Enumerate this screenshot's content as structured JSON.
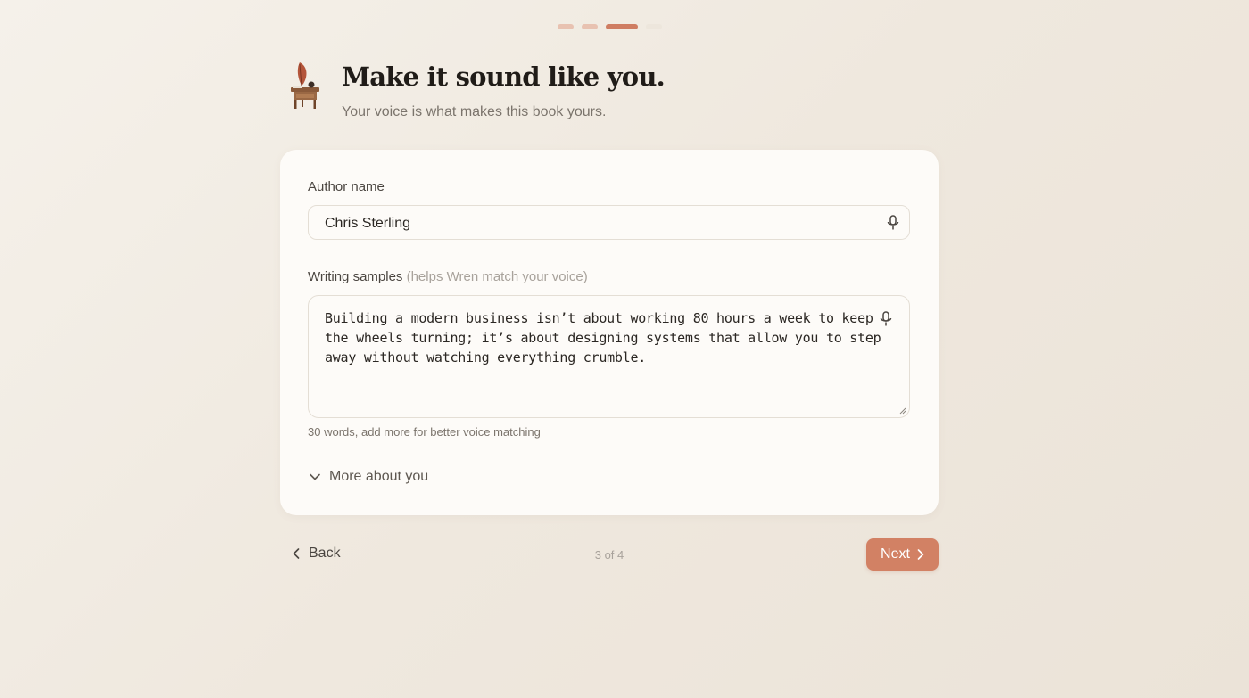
{
  "progress": {
    "total_steps": 4,
    "current_step": 3
  },
  "header": {
    "title": "Make it sound like you.",
    "subtitle": "Your voice is what makes this book yours.",
    "mascot_icon": "quill-desk-icon"
  },
  "form": {
    "author_name": {
      "label": "Author name",
      "value": "Chris Sterling",
      "mic_icon": "microphone-icon"
    },
    "writing_samples": {
      "label": "Writing samples",
      "hint": "(helps Wren match your voice)",
      "value": "Building a modern business isn’t about working 80 hours a week to keep the wheels turning; it’s about designing systems that allow you to step away without watching everything crumble.",
      "mic_icon": "microphone-icon",
      "word_count_text": "30 words, add more for better voice matching"
    },
    "more_about_you": {
      "label": "More about you",
      "icon": "chevron-down-icon"
    }
  },
  "footer": {
    "back_label": "Back",
    "page_indicator": "3 of 4",
    "next_label": "Next"
  },
  "colors": {
    "accent": "#d28164",
    "step_active": "#cf7d62",
    "step_done": "#e8c2b1",
    "background": "#f3eee6"
  }
}
